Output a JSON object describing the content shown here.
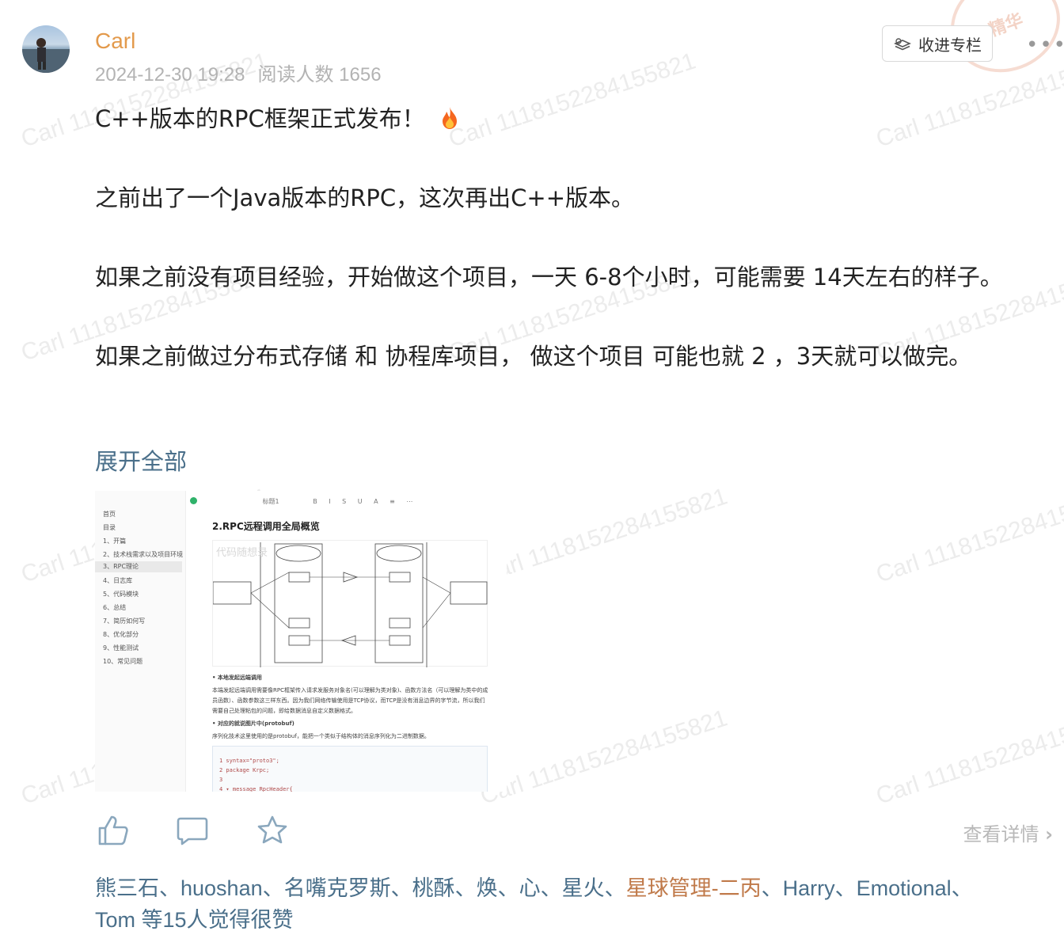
{
  "post": {
    "author": "Carl",
    "date": "2024-12-30 19:28",
    "read_count_label": "阅读人数 1656",
    "collect_label": "收进专栏",
    "more_label": "•••",
    "badge": "精华",
    "paragraphs": [
      "C++版本的RPC框架正式发布！",
      "之前出了一个Java版本的RPC，这次再出C++版本。",
      "如果之前没有项目经验，开始做这个项目，一天 6-8个小时，可能需要 14天左右的样子。",
      "如果之前做过分布式存储 和 协程库项目，  做这个项目 可能也就 2 ，3天就可以做完。"
    ],
    "expand_label": "展开全部",
    "detail_label": "查看详情"
  },
  "watermark": "Carl 1118152284155821",
  "screenshot": {
    "sidebar": [
      "首页",
      "目录",
      "1、开篇",
      "2、技术栈需求以及项目环境",
      "3、RPC理论",
      "4、日志库",
      "5、代码模块",
      "6、总结",
      "7、简历如何写",
      "8、优化部分",
      "9、性能测试",
      "10、常见问题"
    ],
    "toolbar_label": "标题1",
    "title": "2.RPC远程调用全局概览",
    "diagram_watermark": "代码随想录",
    "bullet1": "本地发起远端调用",
    "text1": "本端发起远端调用需要像RPC框架传入请求发服务对象名(可以理解为类对象)、函数方法名（可以理解为类中的成员函数）、函数参数这三样东西。因为我们网络传输使用是TCP协议，而TCP是没有消息边界的字节流，所以我们需要自己处理粘包的问题，即给数据消息自定义数据格式。",
    "bullet2": "对应的就说图片中(protobuf)",
    "text2": "序列化技术这里使用的是protobuf，能把一个类似于结构体的消息序列化为二进制数据。",
    "code": [
      "1   syntax=\"proto3\";",
      "2   package Krpc;",
      "3",
      "4 ▾ message RpcHeader{"
    ]
  },
  "likes": {
    "names": "熊三石、huoshan、名嘴克罗斯、桃酥、焕、心、星火、",
    "highlight": "星球管理-二丙",
    "rest": "、Harry、Emotional、",
    "tail": "Tom 等15人觉得很赞"
  },
  "colors": {
    "author": "#e39a4c",
    "link": "#4a6f8a",
    "highlight": "#c07a4a",
    "meta": "#b3b3b3"
  }
}
